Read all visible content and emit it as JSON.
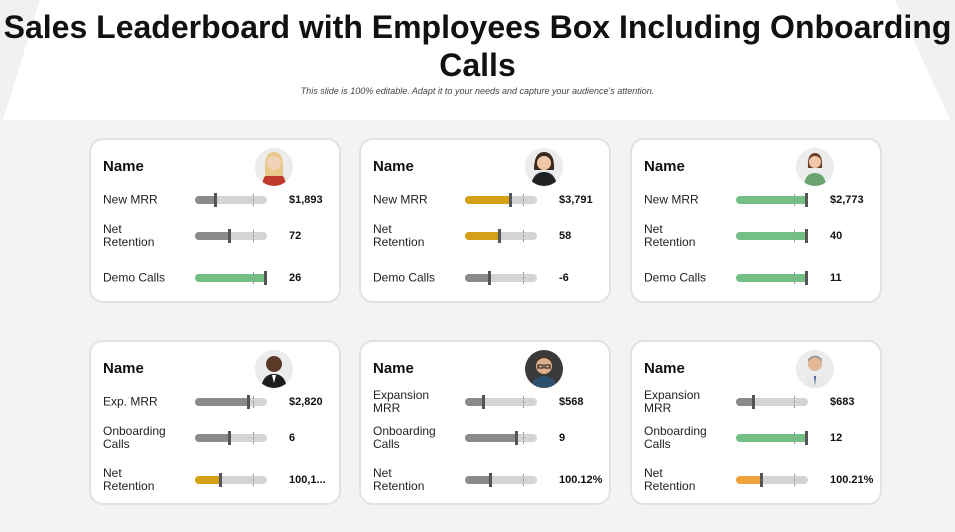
{
  "title": "Sales Leaderboard with Employees Box Including Onboarding Calls",
  "subtitle": "This slide is 100% editable. Adapt it to your needs and capture your audience's attention.",
  "colors": {
    "gray": "#8a8a8a",
    "gold": "#d4a017",
    "green": "#74bf85",
    "orange": "#f0a33b",
    "track": "#d4d4d4"
  },
  "cards": [
    {
      "name": "Name",
      "avatar_icon": "woman-blonde-avatar-icon",
      "metrics": [
        {
          "label": "New MRR",
          "value": "$1,893",
          "level": 0.3,
          "color": "gray"
        },
        {
          "label": "Net\nRetention",
          "value": "72",
          "level": 0.5,
          "color": "gray"
        },
        {
          "label": "Demo Calls",
          "value": "26",
          "level": 1.0,
          "color": "green"
        }
      ]
    },
    {
      "name": "Name",
      "avatar_icon": "woman-brunette-avatar-icon",
      "metrics": [
        {
          "label": "New MRR",
          "value": "$3,791",
          "level": 0.65,
          "color": "gold"
        },
        {
          "label": "Net\nRetention",
          "value": "58",
          "level": 0.5,
          "color": "gold"
        },
        {
          "label": "Demo Calls",
          "value": "-6",
          "level": 0.36,
          "color": "gray"
        }
      ]
    },
    {
      "name": "Name",
      "avatar_icon": "woman-green-top-avatar-icon",
      "metrics": [
        {
          "label": "New MRR",
          "value": "$2,773",
          "level": 1.0,
          "color": "green"
        },
        {
          "label": "Net\nRetention",
          "value": "40",
          "level": 1.0,
          "color": "green"
        },
        {
          "label": "Demo Calls",
          "value": "11",
          "level": 1.0,
          "color": "green"
        }
      ]
    },
    {
      "name": "Name",
      "avatar_icon": "man-suit-avatar-icon",
      "metrics": [
        {
          "label": "Exp. MRR",
          "value": "$2,820",
          "level": 0.77,
          "color": "gray"
        },
        {
          "label": "Onboarding\nCalls",
          "value": "6",
          "level": 0.5,
          "color": "gray"
        },
        {
          "label": "Net\nRetention",
          "value": "100,1...",
          "level": 0.38,
          "color": "gold"
        }
      ]
    },
    {
      "name": "Name",
      "avatar_icon": "man-glasses-avatar-icon",
      "metrics": [
        {
          "label": "Expansion\nMRR",
          "value": "$568",
          "level": 0.28,
          "color": "gray"
        },
        {
          "label": "Onboarding\nCalls",
          "value": "9",
          "level": 0.73,
          "color": "gray"
        },
        {
          "label": "Net\nRetention",
          "value": "100.12%",
          "level": 0.38,
          "color": "gray"
        }
      ]
    },
    {
      "name": "Name",
      "avatar_icon": "man-gray-hair-avatar-icon",
      "metrics": [
        {
          "label": "Expansion\nMRR",
          "value": "$683",
          "level": 0.27,
          "color": "gray"
        },
        {
          "label": "Onboarding\nCalls",
          "value": "12",
          "level": 1.0,
          "color": "green"
        },
        {
          "label": "Net\nRetention",
          "value": "100.21%",
          "level": 0.38,
          "color": "orange"
        }
      ]
    }
  ]
}
